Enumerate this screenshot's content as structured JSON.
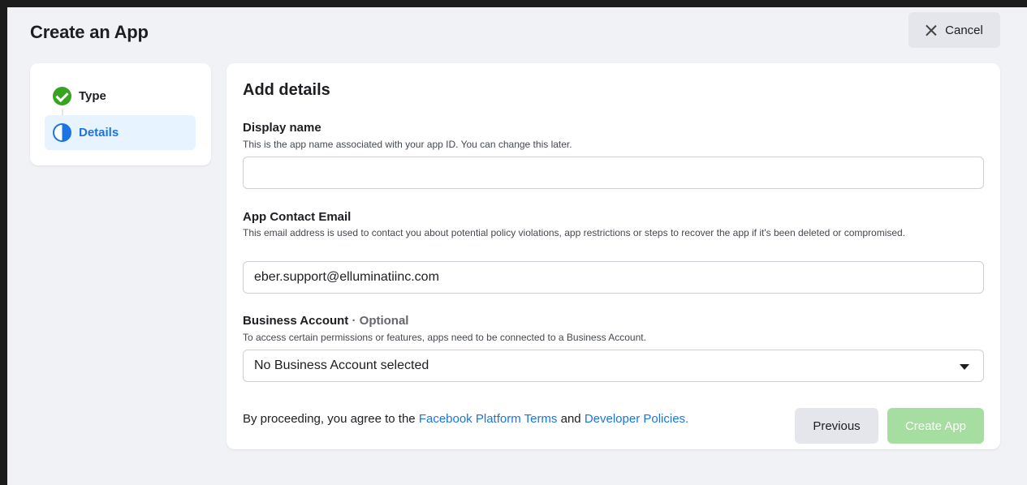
{
  "header": {
    "title": "Create an App",
    "cancel_label": "Cancel"
  },
  "steps": [
    {
      "label": "Type",
      "status": "complete",
      "icon": "check-circle-icon"
    },
    {
      "label": "Details",
      "status": "in-progress",
      "icon": "half-circle-icon"
    }
  ],
  "form": {
    "title": "Add details",
    "display_name": {
      "label": "Display name",
      "help": "This is the app name associated with your app ID. You can change this later.",
      "value": ""
    },
    "contact_email": {
      "label": "App Contact Email",
      "help": "This email address is used to contact you about potential policy violations, app restrictions or steps to recover the app if it's been deleted or compromised.",
      "value": "eber.support@elluminatiinc.com"
    },
    "business_account": {
      "label": "Business Account",
      "optional": "· Optional",
      "help": "To access certain permissions or features, apps need to be connected to a Business Account.",
      "selected": "No Business Account selected"
    }
  },
  "footer": {
    "agree_prefix": "By proceeding, you agree to the ",
    "terms_link": "Facebook Platform Terms",
    "and": " and ",
    "policies_link": "Developer Policies.",
    "previous_label": "Previous",
    "create_label": "Create App"
  },
  "colors": {
    "accent": "#1b74e4",
    "success": "#36a420",
    "create_disabled": "#a6dda0",
    "background": "#f0f2f5"
  }
}
